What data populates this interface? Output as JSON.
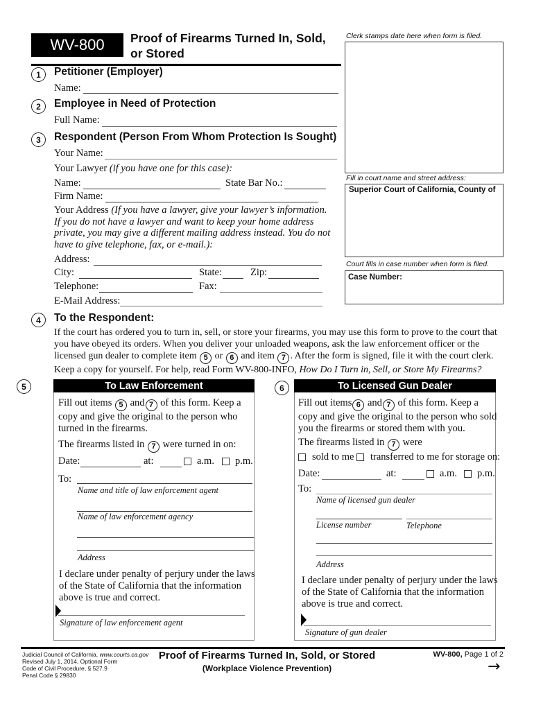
{
  "header": {
    "form_id": "WV-800",
    "title_line1": "Proof of Firearms Turned In, Sold,",
    "title_line2": "or Stored"
  },
  "clerk": {
    "stamp_caption": "Clerk stamps date here when form is filed.",
    "court_caption": "Fill in court name and street address:",
    "court_label": "Superior Court of California, County of",
    "case_caption": "Court fills in case number when form is filed.",
    "case_label": "Case Number:"
  },
  "items": {
    "1": {
      "num": "1",
      "heading": "Petitioner (Employer)",
      "name_label": "Name:",
      "name_value": ""
    },
    "2": {
      "num": "2",
      "heading": "Employee in Need of Protection",
      "name_label": "Full Name:",
      "name_value": ""
    },
    "3": {
      "num": "3",
      "heading": "Respondent (Person From Whom Protection Is Sought)",
      "your_name_label": "Your Name:",
      "lawyer_label": "Your Lawyer",
      "lawyer_note": "(if you have one for this case):",
      "lawyer_name_label": "Name:",
      "bar_label": "State Bar No.:",
      "firm_label": "Firm Name:",
      "address_intro": "Your Address",
      "address_note_1": "(If you have a lawyer, give your lawyer’s information.",
      "address_note_2": "If you do not have a lawyer and want to keep your home address",
      "address_note_3": "private, you may give a different mailing address instead. You do not",
      "address_note_4": "have to give telephone, fax, or e-mail.):",
      "address_label": "Address:",
      "city_label": "City:",
      "state_label": "State:",
      "zip_label": "Zip:",
      "telephone_label": "Telephone:",
      "fax_label": "Fax:",
      "email_label": "E-Mail Address:"
    },
    "4": {
      "num": "4",
      "heading": "To the Respondent:",
      "p1": "If the court has ordered you to turn in, sell, or store your firearms, you may use this form to prove to the court that",
      "p2": "you  have obeyed its orders. When you deliver your unloaded weapons, ask the law enforcement officer or the",
      "p3a": "licensed gun dealer to complete item",
      "p3_ref1": "5",
      "p3b": "or",
      "p3_ref2": "6",
      "p3c": "and item",
      "p3_ref3": "7",
      "p3d": ". After the form is signed, file it with the court clerk.",
      "p4a": "Keep a copy for yourself. For help, read Form WV-800-INFO,",
      "p4b": "How Do I Turn in, Sell, or Store My Firearms?"
    },
    "5": {
      "num": "5",
      "heading": "To Law Enforcement",
      "intro_a": "Fill out items",
      "ref1": "5",
      "intro_b": "and",
      "ref2": "7",
      "intro_c": "of this form. Keep a",
      "intro_2": "copy and give the original to the person who",
      "intro_3": "turned in the firearms.",
      "listed_a": "The firearms listed in",
      "listed_ref": "7",
      "listed_b": "were turned in on:",
      "date_label": "Date:",
      "at_label": "at:",
      "am_label": "a.m.",
      "pm_label": "p.m.",
      "to_label": "To:",
      "agent_caption": "Name and title of law enforcement agent",
      "agency_caption": "Name of law enforcement agency",
      "address_caption": "Address",
      "declare_1": "I declare under penalty of perjury under the laws",
      "declare_2": "of the State of California that the information",
      "declare_3": "above is true and correct.",
      "signature_caption": "Signature of law enforcement agent"
    },
    "6": {
      "num": "6",
      "heading": "To Licensed Gun Dealer",
      "intro_a": "Fill out items",
      "ref1": "6",
      "intro_b": "and",
      "ref2": "7",
      "intro_c": "of this form. Keep a",
      "intro_2": "copy and give the original to the person who sold",
      "intro_3": "you the firearms or stored them with you.",
      "listed_a": "The firearms listed in",
      "listed_ref": "7",
      "listed_b": "were",
      "sold_label": "sold to me",
      "transferred_label": "transferred to me for storage on:",
      "date_label": "Date:",
      "at_label": "at:",
      "am_label": "a.m.",
      "pm_label": "p.m.",
      "to_label": "To:",
      "dealer_caption": "Name of licensed gun dealer",
      "license_caption": "License number",
      "telephone_caption": "Telephone",
      "address_caption": "Address",
      "declare_1": "I declare under penalty of perjury under the laws",
      "declare_2": "of the State of California that the information",
      "declare_3": "above is true and correct.",
      "signature_caption": "Signature of gun dealer"
    }
  },
  "footer": {
    "left_1": "Judicial Council of California,",
    "left_1_url": "www.courts.ca.gov",
    "left_2": "Revised July 1, 2014, Optional Form",
    "left_3": "Code of Civil Procedure, § 527.9",
    "left_4": "Penal Code § 29830",
    "center_title": "Proof of Firearms Turned In, Sold, or Stored",
    "center_sub": "(Workplace Violence Prevention)",
    "right_form": "WV-800,",
    "right_page": "Page 1 of 2",
    "next_icon": "arrow-right-icon"
  }
}
